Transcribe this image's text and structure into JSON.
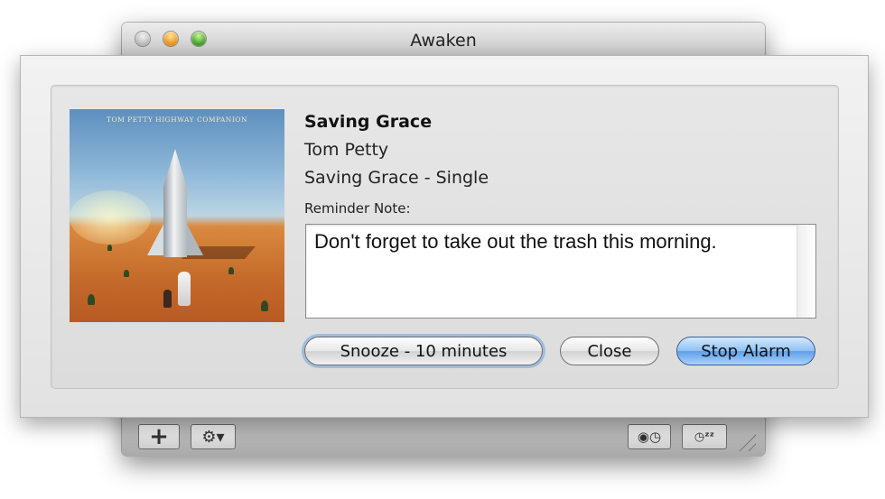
{
  "window": {
    "title": "Awaken"
  },
  "toolbar": {
    "add_label": "+",
    "gear_label": "⚙▾",
    "alarm_label": "◉◷",
    "sleep_label": "◷ᶻᶻ"
  },
  "now_playing": {
    "song_title": "Saving Grace",
    "artist": "Tom Petty",
    "album": "Saving Grace - Single",
    "album_art_text": "TOM PETTY  HIGHWAY COMPANION"
  },
  "reminder": {
    "label": "Reminder Note:",
    "text": "Don't forget to take out the trash this morning."
  },
  "buttons": {
    "snooze": "Snooze - 10 minutes",
    "close": "Close",
    "stop_alarm": "Stop Alarm"
  },
  "colors": {
    "accent_blue": "#5e9fe8",
    "focus_ring": "#6ea0dc"
  }
}
